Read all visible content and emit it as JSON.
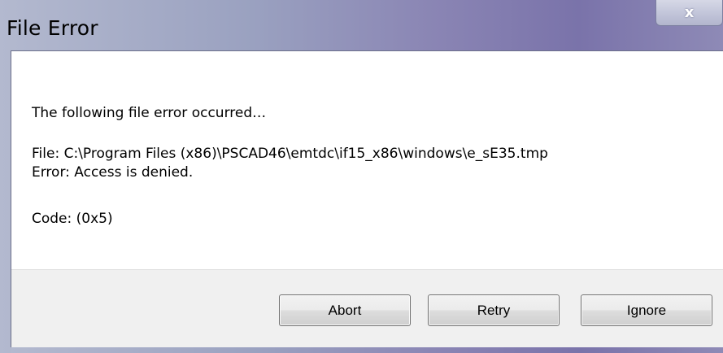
{
  "window": {
    "title": "File Error",
    "close_glyph": "x"
  },
  "message": {
    "intro": "The following file error occurred…",
    "file_line": "File: C:\\Program Files (x86)\\PSCAD46\\emtdc\\if15_x86\\windows\\e_sE35.tmp",
    "error_line": "Error: Access is denied.",
    "code_line": "Code: (0x5)"
  },
  "buttons": {
    "abort": "Abort",
    "retry": "Retry",
    "ignore": "Ignore"
  },
  "colors": {
    "title_bar_gradient_start": "#b3b9cf",
    "title_bar_gradient_end": "#7a73aa",
    "footer_background": "#f0f0f0"
  }
}
